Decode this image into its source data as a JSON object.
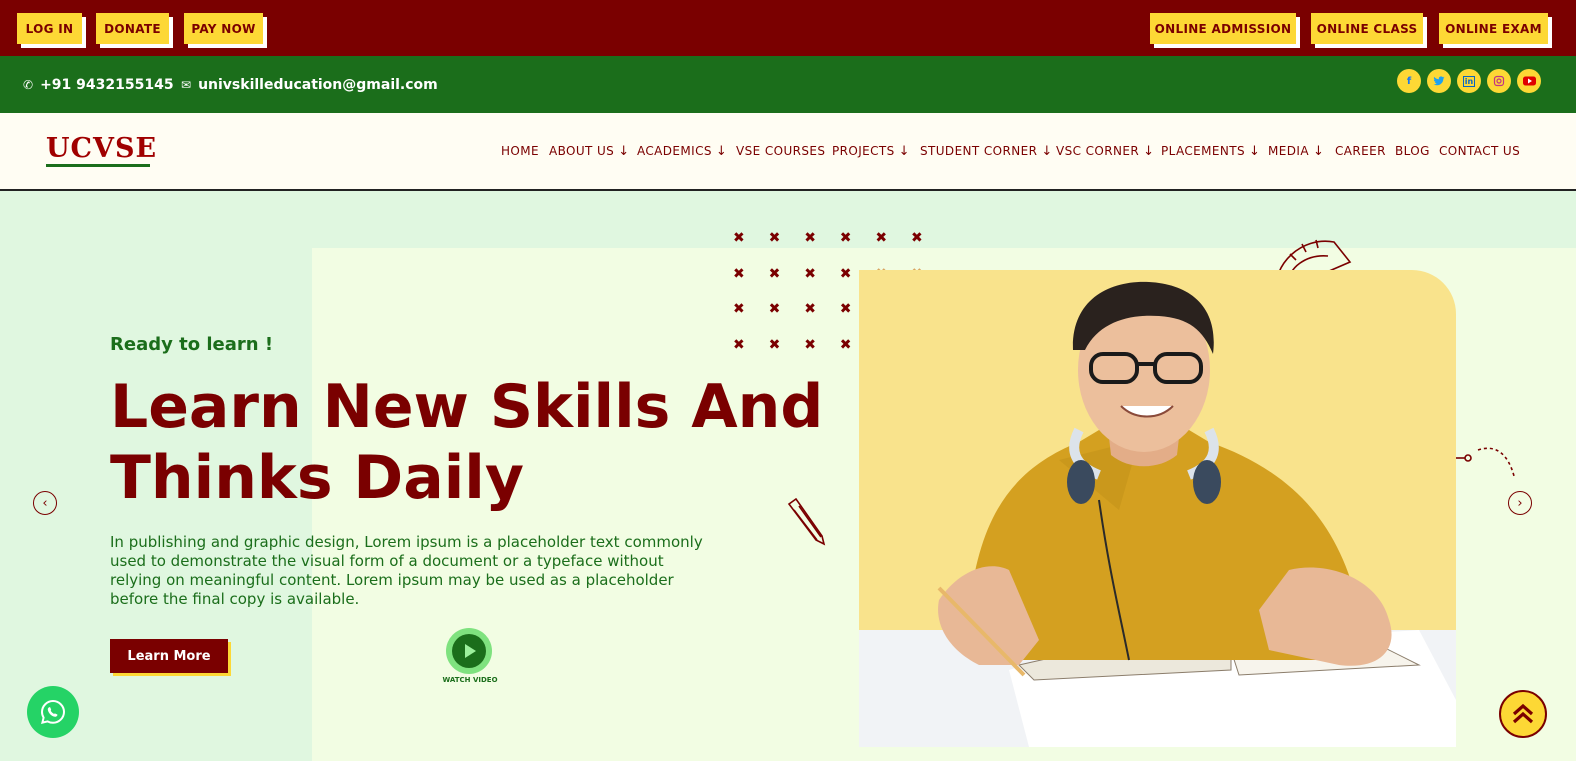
{
  "topbar": {
    "left_buttons": [
      "LOG IN",
      "DONATE",
      "PAY NOW"
    ],
    "right_buttons": [
      "ONLINE ADMISSION",
      "ONLINE CLASS",
      "ONLINE EXAM"
    ]
  },
  "contact": {
    "phone": "+91 9432155145",
    "email": "univskilleducation@gmail.com",
    "phone_icon": "phone-icon",
    "email_icon": "mail-icon",
    "social_icons": [
      "facebook-icon",
      "twitter-icon",
      "linkedin-icon",
      "instagram-icon",
      "youtube-icon"
    ]
  },
  "logo": {
    "text": "UCVSE"
  },
  "nav": {
    "items": [
      {
        "label": "HOME",
        "dropdown": false
      },
      {
        "label": "ABOUT US",
        "dropdown": true
      },
      {
        "label": "ACADEMICS",
        "dropdown": true
      },
      {
        "label": "VSE COURSES",
        "dropdown": false
      },
      {
        "label": "PROJECTS",
        "dropdown": true
      },
      {
        "label": "STUDENT CORNER",
        "dropdown": true
      },
      {
        "label": "VSC CORNER",
        "dropdown": true
      },
      {
        "label": "PLACEMENTS",
        "dropdown": true
      },
      {
        "label": "MEDIA",
        "dropdown": true
      },
      {
        "label": "CAREER",
        "dropdown": false
      },
      {
        "label": "BLOG",
        "dropdown": false
      },
      {
        "label": "CONTACT US",
        "dropdown": false
      }
    ]
  },
  "hero": {
    "kicker": "Ready to learn !",
    "headline_line1": "Learn New Skills And",
    "headline_line2": "Thinks Daily",
    "paragraph": "In publishing and graphic design, Lorem ipsum is a placeholder text commonly used to demonstrate the visual form of a document or a typeface without relying on meaningful content. Lorem ipsum may be used as a placeholder before the final copy is available.",
    "cta_label": "Learn More",
    "watch_label": "WATCH VIDEO",
    "image_subject": "student-with-headphones-photo"
  },
  "colors": {
    "maroon": "#7a0000",
    "green": "#1b6e1b",
    "yellow": "#fdd835",
    "hero_bg": "#e0f7e0",
    "hero_panel": "#f2fde3"
  }
}
